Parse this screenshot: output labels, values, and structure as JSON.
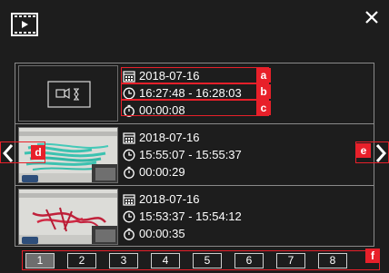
{
  "recordings": [
    {
      "date": "2018-07-16",
      "time_range": "16:27:48 - 16:28:03",
      "duration": "00:00:08",
      "thumbnail": "no-preview-placeholder"
    },
    {
      "date": "2018-07-16",
      "time_range": "15:55:07 - 15:55:37",
      "duration": "00:00:29",
      "thumbnail": "video-frame"
    },
    {
      "date": "2018-07-16",
      "time_range": "15:53:37 - 15:54:12",
      "duration": "00:00:35",
      "thumbnail": "video-frame"
    }
  ],
  "callouts": {
    "a": "a",
    "b": "b",
    "c": "c",
    "d": "d",
    "e": "e",
    "f": "f"
  },
  "pagination": {
    "pages": [
      "1",
      "2",
      "3",
      "4",
      "5",
      "6",
      "7",
      "8"
    ],
    "active_page": "1"
  },
  "icons": {
    "header": "film-icon",
    "close": "close-icon",
    "date": "calendar-icon",
    "time": "clock-icon",
    "duration": "stopwatch-icon",
    "prev": "chevron-left-icon",
    "next": "chevron-right-icon"
  },
  "colors": {
    "accent": "#e8202a",
    "background": "#1d1d1d",
    "text": "#ffffff"
  }
}
